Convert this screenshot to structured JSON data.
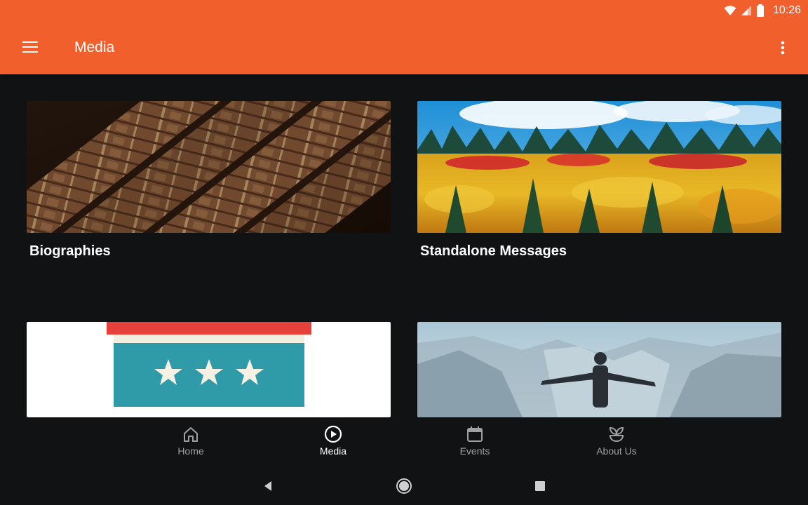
{
  "status_bar": {
    "time": "10:26",
    "icons": [
      "wifi-icon",
      "cell-signal-icon",
      "battery-icon"
    ]
  },
  "app_bar": {
    "title": "Media",
    "menu_icon": "hamburger-menu-icon",
    "overflow_icon": "more-vert-icon",
    "color": "#f15f2d"
  },
  "cards": [
    {
      "label": "Biographies",
      "image": "bookshelf-photo"
    },
    {
      "label": "Standalone Messages",
      "image": "autumn-forest-photo"
    },
    {
      "label": "",
      "image": "stars-banner-illustration"
    },
    {
      "label": "",
      "image": "man-on-cliff-photo"
    }
  ],
  "bottom_nav": {
    "items": [
      {
        "label": "Home",
        "icon": "home-icon",
        "active": false
      },
      {
        "label": "Media",
        "icon": "play-circle-icon",
        "active": true
      },
      {
        "label": "Events",
        "icon": "calendar-icon",
        "active": false
      },
      {
        "label": "About Us",
        "icon": "sprout-icon",
        "active": false
      }
    ]
  },
  "system_nav": {
    "icons": [
      "back-icon",
      "home-circle-icon",
      "recents-icon"
    ]
  }
}
